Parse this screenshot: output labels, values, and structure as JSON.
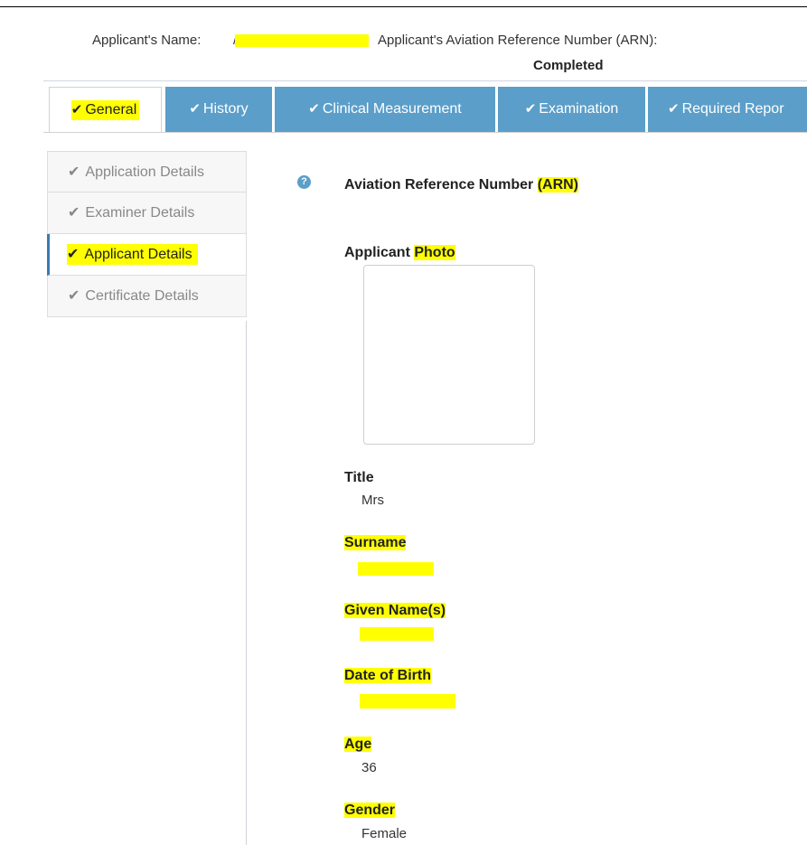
{
  "header": {
    "name_label": "Applicant's Name:",
    "name_value": "/",
    "arn_label": "Applicant's Aviation Reference Number (ARN):",
    "status": "Completed"
  },
  "tabs": [
    {
      "label": "General",
      "active": true
    },
    {
      "label": "History",
      "active": false
    },
    {
      "label": "Clinical Measurement",
      "active": false
    },
    {
      "label": "Examination",
      "active": false
    },
    {
      "label": "Required Repor",
      "active": false
    }
  ],
  "sidebar": {
    "items": [
      {
        "label": "Application Details",
        "active": false
      },
      {
        "label": "Examiner Details",
        "active": false
      },
      {
        "label": "Applicant Details",
        "active": true
      },
      {
        "label": "Certificate Details",
        "active": false
      }
    ]
  },
  "icons": {
    "check": "check-icon",
    "help": "help-icon"
  },
  "fields": {
    "arn": {
      "label_main": "Aviation Reference Number ",
      "label_mark": "(ARN)"
    },
    "photo": {
      "label_main": "Applicant ",
      "label_mark": "Photo"
    },
    "title": {
      "label": "Title",
      "value": "Mrs"
    },
    "surname": {
      "label": "Surname"
    },
    "given_names": {
      "label": "Given Name(s)"
    },
    "dob": {
      "label": "Date of Birth"
    },
    "age": {
      "label": "Age",
      "value": "36"
    },
    "gender": {
      "label": "Gender",
      "value": "Female"
    }
  },
  "colors": {
    "tab_blue": "#5b9ec9",
    "highlight": "#ffff00",
    "active_border": "#3a7ab3"
  }
}
